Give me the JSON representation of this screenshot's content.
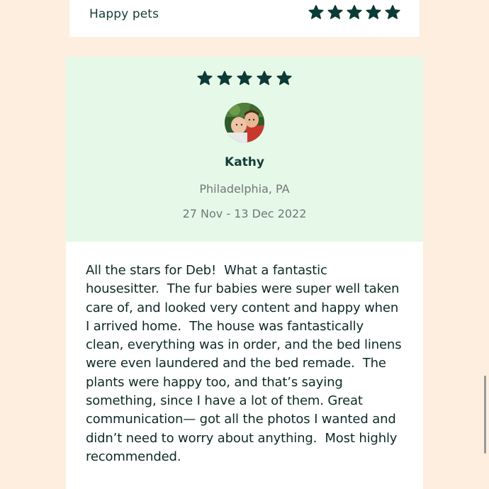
{
  "previous_review": {
    "rating_label": "Happy pets",
    "rating_stars": 5
  },
  "review": {
    "stars": 5,
    "reviewer_name": "Kathy",
    "location": "Philadelphia, PA",
    "dates": "27 Nov - 13 Dec 2022",
    "text": "All the stars for Deb!  What a fantastic housesitter.  The fur babies were super well taken care of, and looked very content and happy when I arrived home.  The house was fantastically clean, everything was in order, and the bed linens were even laundered and the bed remade.  The plants were happy too, and that’s saying something, since I have a lot of them. Great communication— got all the photos I wanted and didn’t need to worry about anything.  Most highly recommended."
  },
  "colors": {
    "page_background": "#fdeee0",
    "card_background": "#ffffff",
    "review_header_background": "#e6f8e7",
    "star_color": "#0c3b35",
    "primary_text": "#123d37",
    "muted_text": "#6f7876"
  },
  "icons": {
    "star": "star-icon"
  }
}
